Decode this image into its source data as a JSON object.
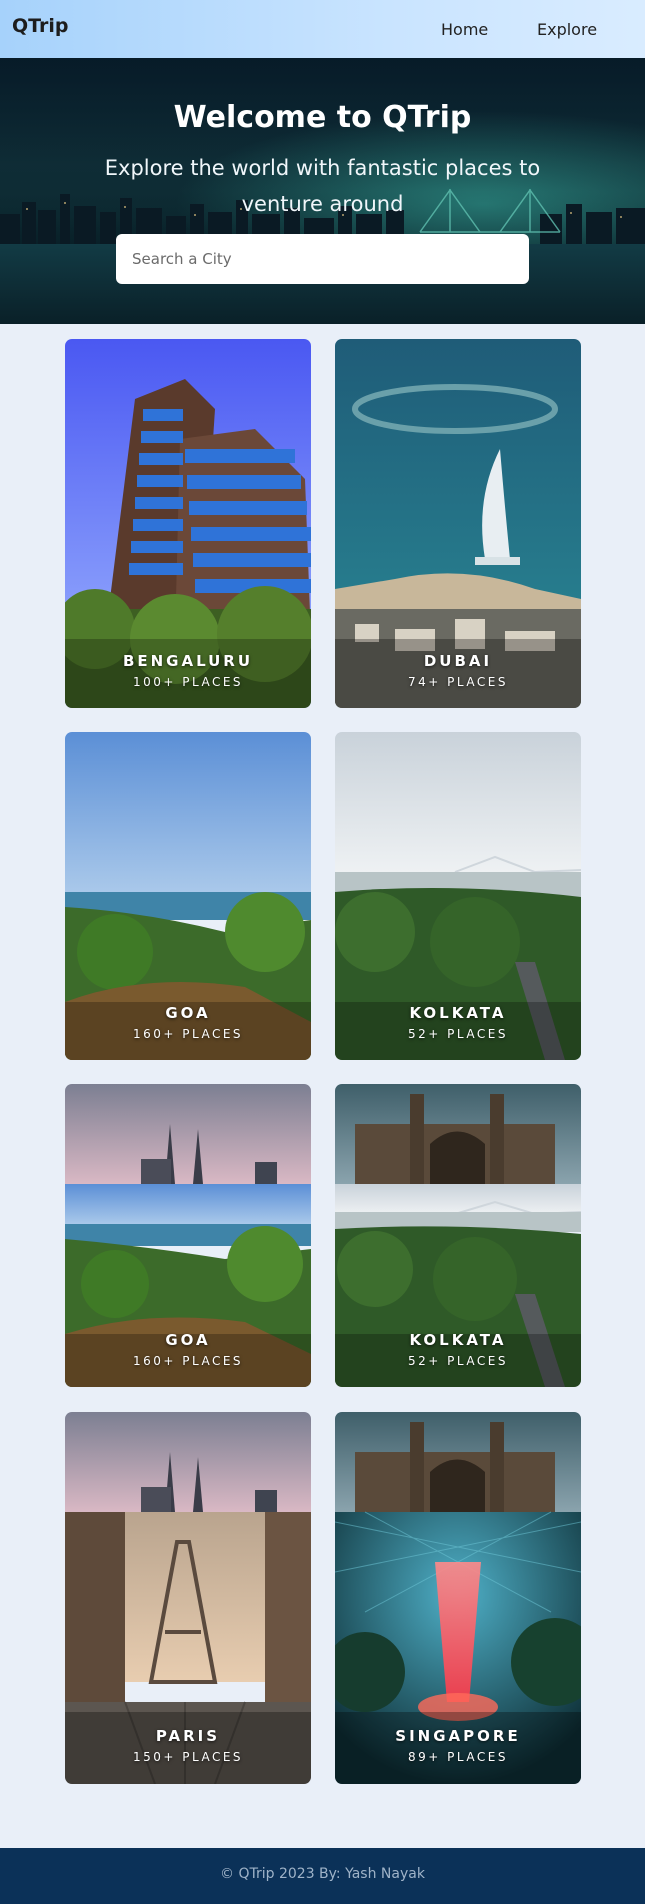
{
  "header": {
    "brand": "QTrip",
    "nav": [
      {
        "label": "Home"
      },
      {
        "label": "Explore"
      }
    ]
  },
  "hero": {
    "title": "Welcome to QTrip",
    "subtitle": "Explore the world with fantastic places to venture around",
    "search_placeholder": "Search a City"
  },
  "cities": [
    {
      "name": "BENGALURU",
      "places": "100+ PLACES"
    },
    {
      "name": "DUBAI",
      "places": "74+ PLACES"
    },
    {
      "name": "GOA",
      "places": "160+ PLACES"
    },
    {
      "name": "KOLKATA",
      "places": "52+ PLACES"
    },
    {
      "name": "GOA",
      "places": "160+ PLACES"
    },
    {
      "name": "KOLKATA",
      "places": "52+ PLACES"
    },
    {
      "name": "PARIS",
      "places": "150+ PLACES"
    },
    {
      "name": "SINGAPORE",
      "places": "89+ PLACES"
    }
  ],
  "footer": {
    "text": "© QTrip 2023 By: Yash Nayak"
  },
  "colors": {
    "navbar": "#a6d2fb",
    "page_bg": "#e9eff8",
    "footer_bg": "#0b3158",
    "footer_text": "#9fb3c8"
  }
}
